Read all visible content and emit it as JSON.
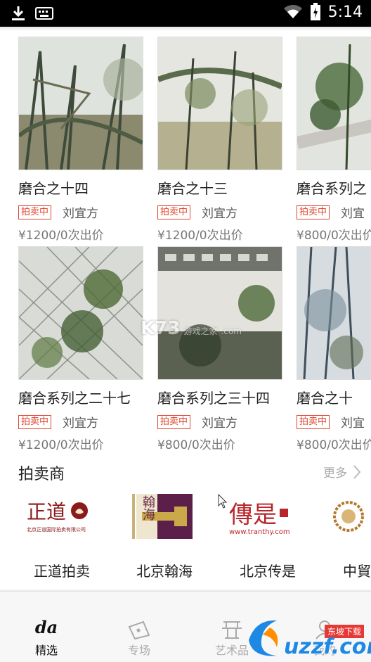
{
  "status": {
    "time": "5:14"
  },
  "artworks_row1": [
    {
      "title": "磨合之十四",
      "badge": "拍卖中",
      "artist": "刘宜方",
      "price": "¥1200/0次出价"
    },
    {
      "title": "磨合之十三",
      "badge": "拍卖中",
      "artist": "刘宜方",
      "price": "¥1200/0次出价"
    },
    {
      "title": "磨合系列之",
      "badge": "拍卖中",
      "artist": "刘宜",
      "price": "¥800/0次出价"
    }
  ],
  "artworks_row2": [
    {
      "title": "磨合系列之二十七",
      "badge": "拍卖中",
      "artist": "刘宜方",
      "price": "¥1200/0次出价"
    },
    {
      "title": "磨合系列之三十四",
      "badge": "拍卖中",
      "artist": "刘宜方",
      "price": "¥800/0次出价"
    },
    {
      "title": "磨合之十",
      "badge": "拍卖中",
      "artist": "刘宜",
      "price": "¥800/0次出价"
    }
  ],
  "auctioneers": {
    "title": "拍卖商",
    "more": "更多",
    "items": [
      {
        "name": "正道拍卖",
        "logo_text": "正道",
        "logo_sub": "北京正道国际拍卖有限公司"
      },
      {
        "name": "北京翰海",
        "logo_text": "翰海"
      },
      {
        "name": "北京传是",
        "logo_text": "傳是",
        "logo_sub": "www.tranthy.com"
      },
      {
        "name": "中貿"
      }
    ]
  },
  "watermark": {
    "k73": "K73",
    "k73_cn": "游戏之家",
    "k73_domain": ".com",
    "uzzf": "uzzf.com",
    "uzzf_tag": "东坡下载"
  },
  "tabs": [
    {
      "label": "精选",
      "icon_text": "da",
      "active": true
    },
    {
      "label": "专场",
      "active": false
    },
    {
      "label": "艺术品",
      "active": false
    },
    {
      "label": "我的",
      "active": false
    }
  ],
  "colors": {
    "accent_red": "#e0452d",
    "text_gray": "#777777",
    "tab_inactive": "#aaaaaa"
  }
}
